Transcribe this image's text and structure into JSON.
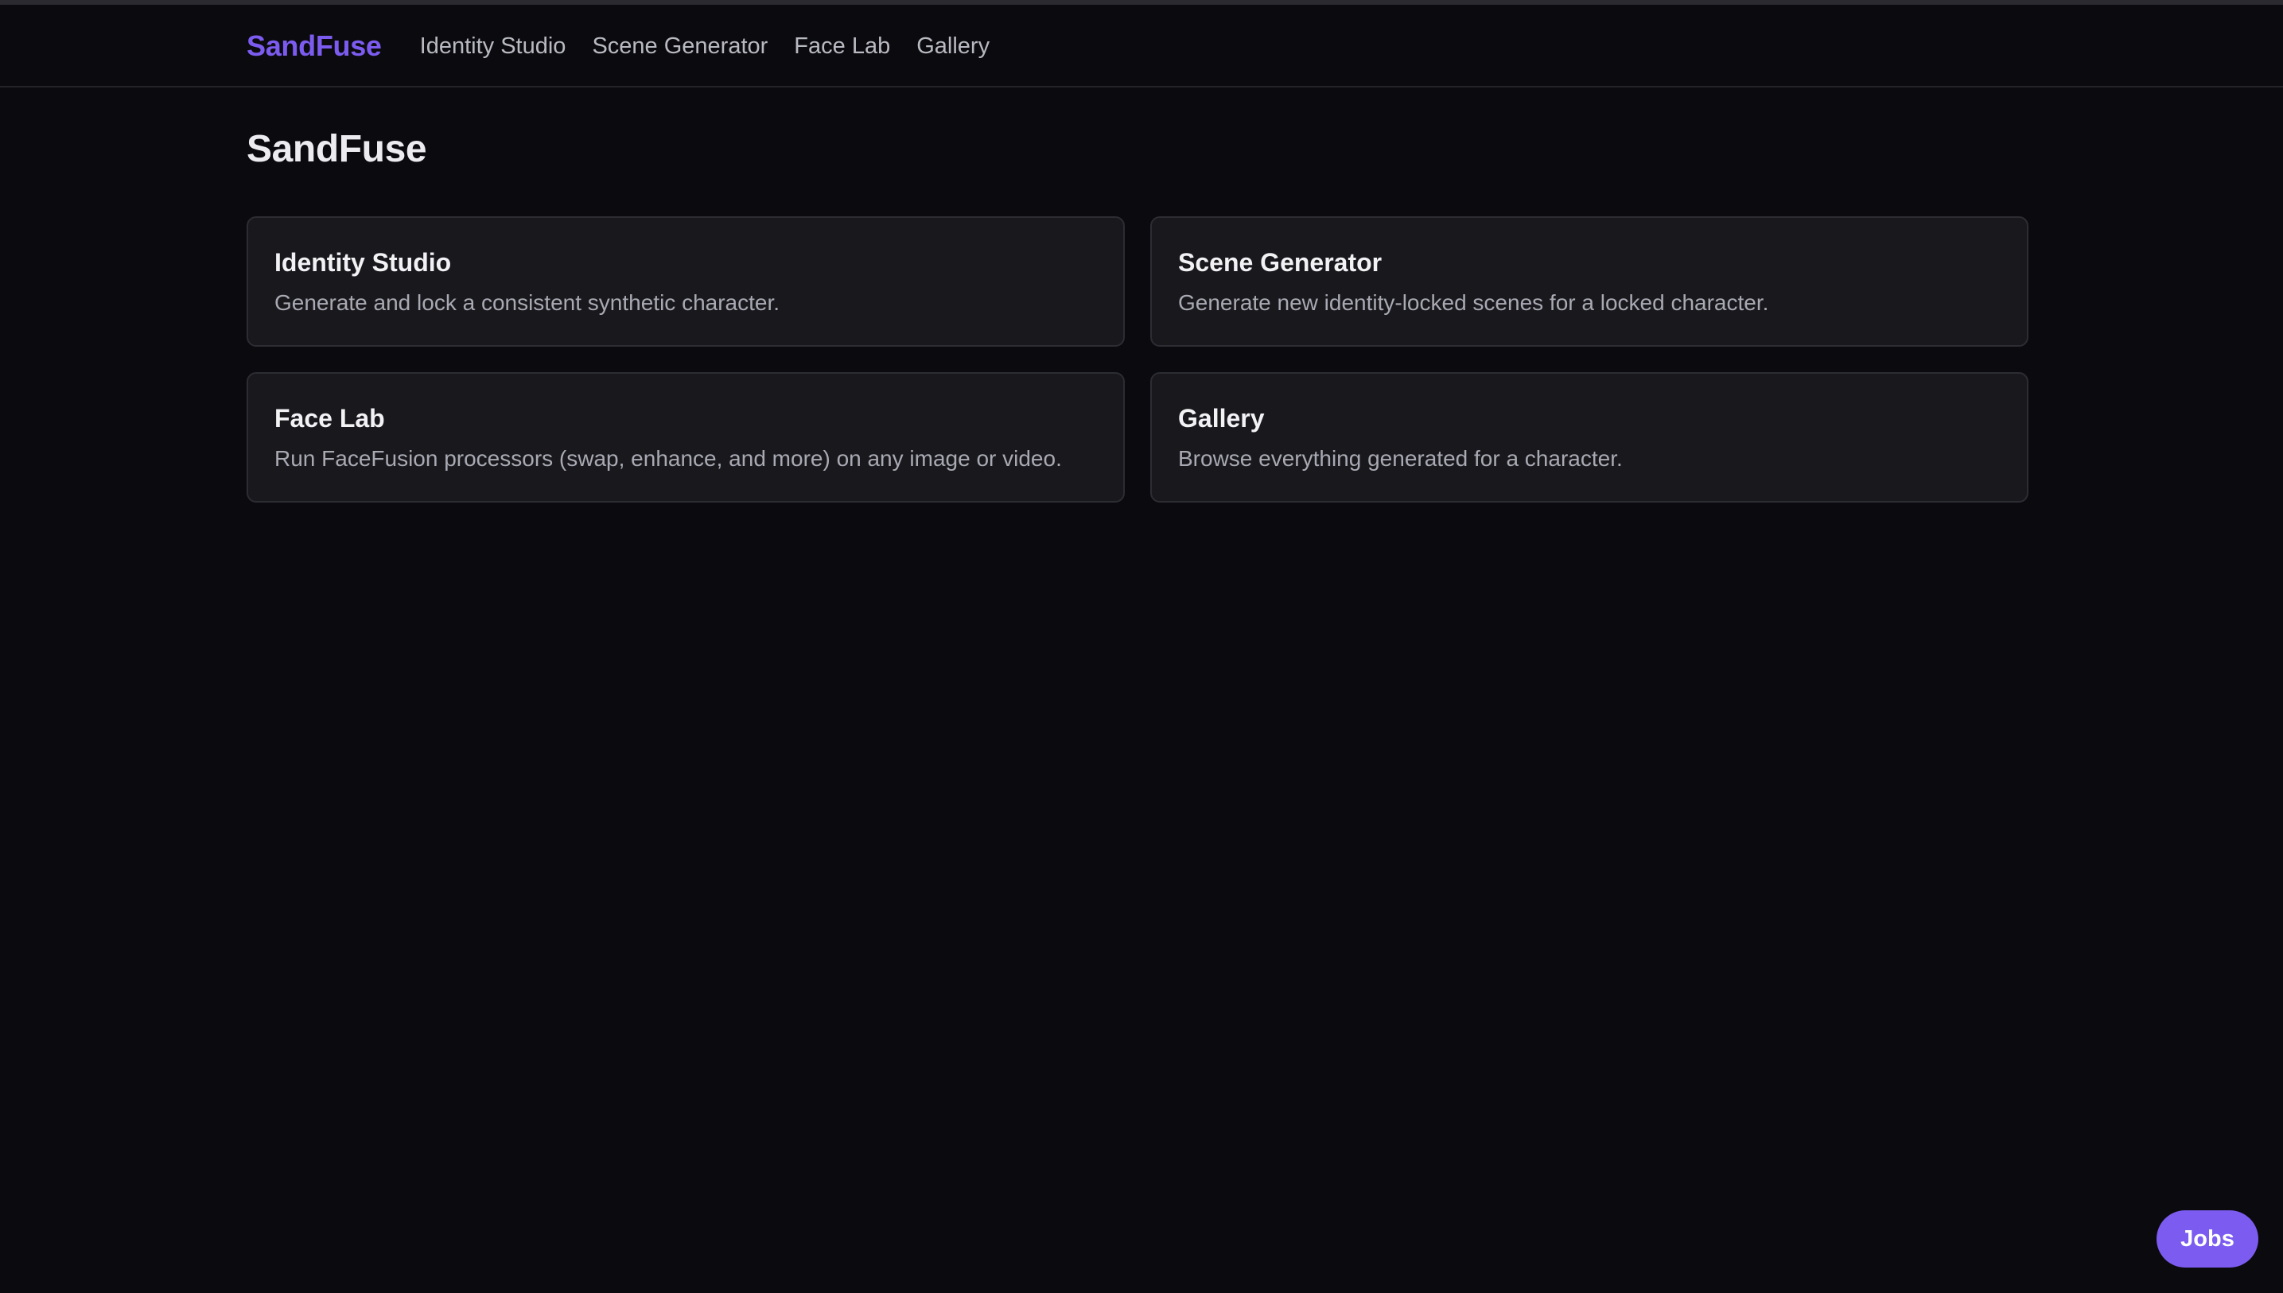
{
  "nav": {
    "brand": "SandFuse",
    "links": [
      {
        "label": "Identity Studio"
      },
      {
        "label": "Scene Generator"
      },
      {
        "label": "Face Lab"
      },
      {
        "label": "Gallery"
      }
    ]
  },
  "main": {
    "title": "SandFuse",
    "cards": [
      {
        "title": "Identity Studio",
        "description": "Generate and lock a consistent synthetic character."
      },
      {
        "title": "Scene Generator",
        "description": "Generate new identity-locked scenes for a locked character."
      },
      {
        "title": "Face Lab",
        "description": "Run FaceFusion processors (swap, enhance, and more) on any image or video."
      },
      {
        "title": "Gallery",
        "description": "Browse everything generated for a character."
      }
    ]
  },
  "jobs_button": {
    "label": "Jobs"
  },
  "colors": {
    "background": "#0b0b0f",
    "accent": "#7c5cf0",
    "card_background": "#18181d",
    "card_border": "#2c2c33"
  }
}
